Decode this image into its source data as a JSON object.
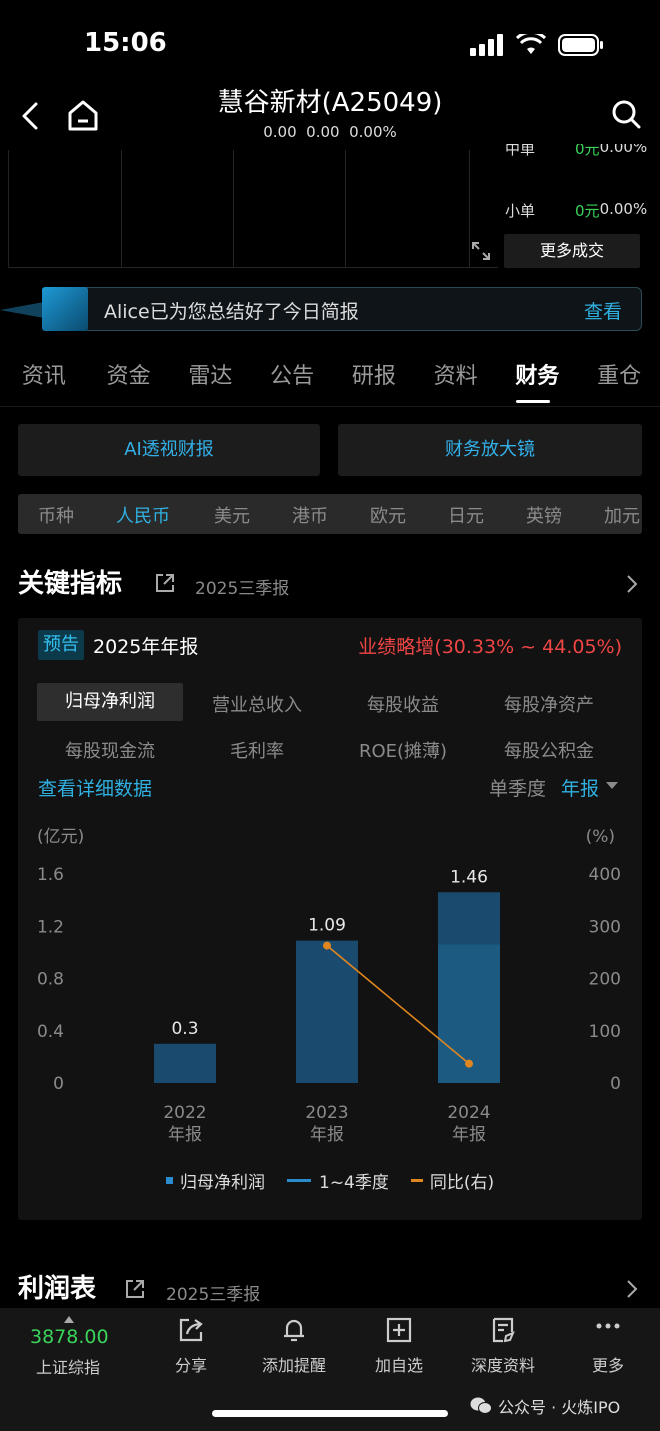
{
  "status": {
    "time": "15:06"
  },
  "nav": {
    "title": "慧谷新材(A25049)",
    "sub": "0.00  0.00  0.00%"
  },
  "trades": [
    {
      "label": "中单",
      "value": "0元",
      "pct": "0.00%"
    },
    {
      "label": "小单",
      "value": "0元",
      "pct": "0.00%"
    }
  ],
  "more_trade": "更多成交",
  "alice": {
    "text": "Alice已为您总结好了今日简报",
    "link": "查看"
  },
  "tabs": [
    "资讯",
    "资金",
    "雷达",
    "公告",
    "研报",
    "资料",
    "财务",
    "重仓"
  ],
  "active_tab": "财务",
  "ai_buttons": [
    "AI透视财报",
    "财务放大镜"
  ],
  "currency": {
    "label": "币种",
    "options": [
      "人民币",
      "美元",
      "港币",
      "欧元",
      "日元",
      "英镑",
      "加元"
    ],
    "selected": "人民币"
  },
  "section1": {
    "title": "关键指标",
    "period": "2025三季报"
  },
  "card": {
    "badge": "预告",
    "report": "2025年年报",
    "performance": "业绩略增(30.33% ~ 44.05%)",
    "metrics": [
      "归母净利润",
      "营业总收入",
      "每股收益",
      "每股净资产",
      "每股现金流",
      "毛利率",
      "ROE(摊薄)",
      "每股公积金"
    ],
    "selected_metric": "归母净利润",
    "detail_link": "查看详细数据",
    "season": "单季度",
    "annual": "年报"
  },
  "chart_data": {
    "type": "bar",
    "categories": [
      "2022\n年报",
      "2023\n年报",
      "2024\n年报"
    ],
    "category_years": [
      "2022",
      "2023",
      "2024"
    ],
    "category_sub": [
      "年报",
      "年报",
      "年报"
    ],
    "values": [
      0.3,
      1.09,
      1.46
    ],
    "value_labels": [
      "0.3",
      "1.09",
      "1.46"
    ],
    "yoy": [
      null,
      263,
      37
    ],
    "y_left_unit": "(亿元)",
    "y_right_unit": "(%)",
    "y_left_ticks": [
      "1.6",
      "1.2",
      "0.8",
      "0.4",
      "0"
    ],
    "y_right_ticks": [
      "400",
      "300",
      "200",
      "100",
      "0"
    ],
    "ylim": [
      0,
      1.6
    ],
    "y2lim": [
      0,
      400
    ],
    "legend": [
      "归母净利润",
      "1~4季度",
      "同比(右)"
    ],
    "colors": {
      "bar": "#1a4a6e",
      "bar_top": "#1e4f72",
      "bar_bottom": "#1c5a82",
      "line": "#e0861e"
    }
  },
  "section2": {
    "title": "利润表",
    "period": "2025三季报"
  },
  "bottom": {
    "index_value": "3878.00",
    "index_name": "上证综指",
    "items": [
      "分享",
      "添加提醒",
      "加自选",
      "深度资料",
      "更多"
    ]
  },
  "watermark": "公众号 · 火炼IPO"
}
